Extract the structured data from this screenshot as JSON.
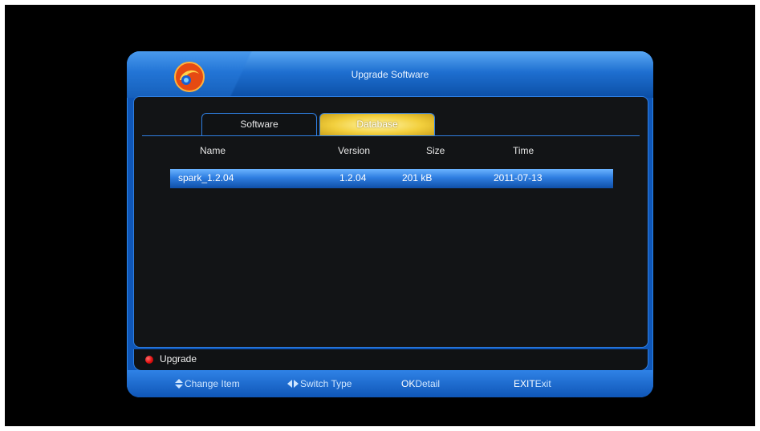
{
  "window": {
    "title": "Upgrade Software"
  },
  "tabs": [
    {
      "label": "Software",
      "selected": false
    },
    {
      "label": "Database",
      "selected": true
    }
  ],
  "table": {
    "columns": [
      "Name",
      "Version",
      "Size",
      "Time"
    ],
    "rows": [
      {
        "name": "spark_1.2.04",
        "version": "1.2.04",
        "size": "201 kB",
        "time": "2011-07-13",
        "selected": true
      }
    ]
  },
  "footer": {
    "red_button_label": "Upgrade"
  },
  "help": {
    "change_item": "Change Item",
    "switch_type": "Switch Type",
    "ok_key": "OK",
    "ok_action": "Detail",
    "exit_key": "EXIT",
    "exit_action": "Exit"
  },
  "colors": {
    "accent_blue": "#0f56b7",
    "selection_blue": "#2e7de0",
    "tab_active_yellow": "#f2cf3d",
    "red_button": "#e01010"
  },
  "icons": [
    "app-logo-icon",
    "red-button-icon",
    "up-down-arrow-icon",
    "left-right-arrow-icon"
  ]
}
